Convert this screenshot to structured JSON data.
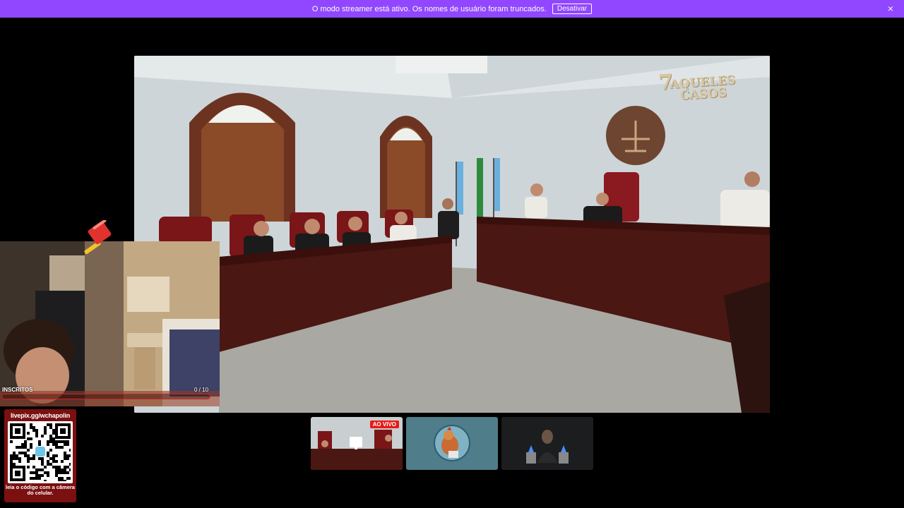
{
  "banner": {
    "message": "O modo streamer está ativo. Os nomes de usuário foram truncados.",
    "button_label": "Desativar",
    "close_glyph": "×",
    "color": "#9147ff"
  },
  "video": {
    "watermark_line1": "AQUELES",
    "watermark_line2": "CASOS",
    "watermark_number": "7"
  },
  "overlay": {
    "subs_label": "INSCRITOS",
    "subs_count": "0 / 10",
    "subs_progress": 0,
    "bar_color": "#d32020",
    "hammer_icon": "gavel-icon"
  },
  "qr_panel": {
    "url": "livepix.gg/wchapolin",
    "caption": "leia o código com a câmera do celular.",
    "background": "#7a1010"
  },
  "thumbnails": [
    {
      "badge": "AO VIVO",
      "icon": "screen-icon",
      "state": "live"
    },
    {
      "icon": "rooster-avatar-icon",
      "state": "active"
    },
    {
      "icon": "person-avatar-icon",
      "state": "default"
    }
  ]
}
